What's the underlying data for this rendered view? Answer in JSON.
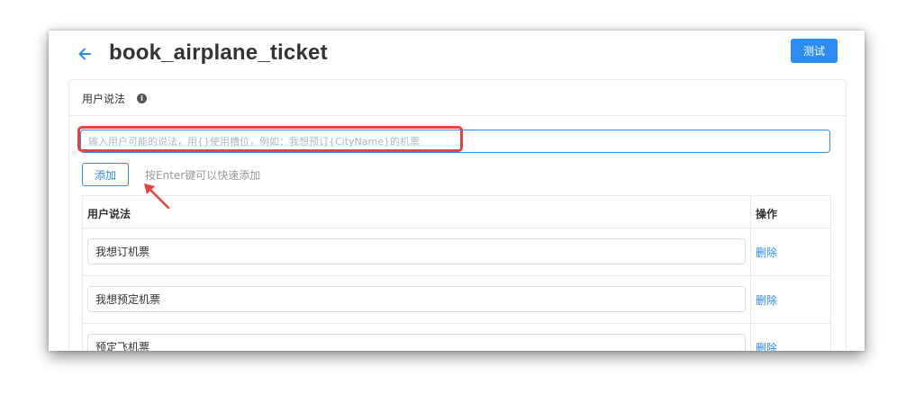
{
  "header": {
    "title": "book_airplane_ticket",
    "test_button_label": "测试"
  },
  "card": {
    "title": "用户说法",
    "info_icon_glyph": "i"
  },
  "input": {
    "placeholder": "输入用户可能的说法，用{}使用槽位，例如：我想预订{CityName}的机票",
    "value": ""
  },
  "add_button_label": "添加",
  "hint": "按Enter键可以快速添加",
  "table": {
    "headers": {
      "utterance": "用户说法",
      "operation": "操作"
    },
    "rows": [
      {
        "utterance": "我想订机票",
        "action": "删除"
      },
      {
        "utterance": "我想预定机票",
        "action": "删除"
      },
      {
        "utterance": "预定飞机票",
        "action": "删除"
      }
    ]
  },
  "colors": {
    "accent": "#2d8cf0",
    "annotation": "#e8423f",
    "border": "#e8eaec"
  },
  "icons": {
    "back": "arrow-left-icon",
    "info": "info-circle-icon",
    "annotation_arrow": "annotation-arrow-icon"
  }
}
